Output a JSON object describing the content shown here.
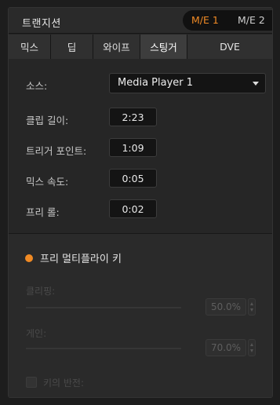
{
  "header": {
    "title": "트랜지션",
    "me_buttons": [
      {
        "label": "M/E 1",
        "active": true
      },
      {
        "label": "M/E 2",
        "active": false
      }
    ]
  },
  "tabs": [
    {
      "label": "믹스",
      "active": false
    },
    {
      "label": "딥",
      "active": false
    },
    {
      "label": "와이프",
      "active": false
    },
    {
      "label": "스팅거",
      "active": true
    },
    {
      "label": "DVE",
      "active": false
    }
  ],
  "stinger": {
    "source": {
      "label": "소스:",
      "value": "Media Player 1"
    },
    "clip_duration": {
      "label": "클립 길이:",
      "value": "2:23"
    },
    "trigger_point": {
      "label": "트리거 포인트:",
      "value": "1:09"
    },
    "mix_rate": {
      "label": "믹스 속도:",
      "value": "0:05"
    },
    "pre_roll": {
      "label": "프리 롤:",
      "value": "0:02"
    }
  },
  "key": {
    "premultiplied_label": "프리 멀티플라이 키",
    "clip": {
      "label": "클리핑:",
      "value": "50.0%"
    },
    "gain": {
      "label": "게인:",
      "value": "70.0%"
    },
    "invert_label": "키의 반전:"
  },
  "colors": {
    "accent": "#f08a24",
    "background": "#262626"
  }
}
